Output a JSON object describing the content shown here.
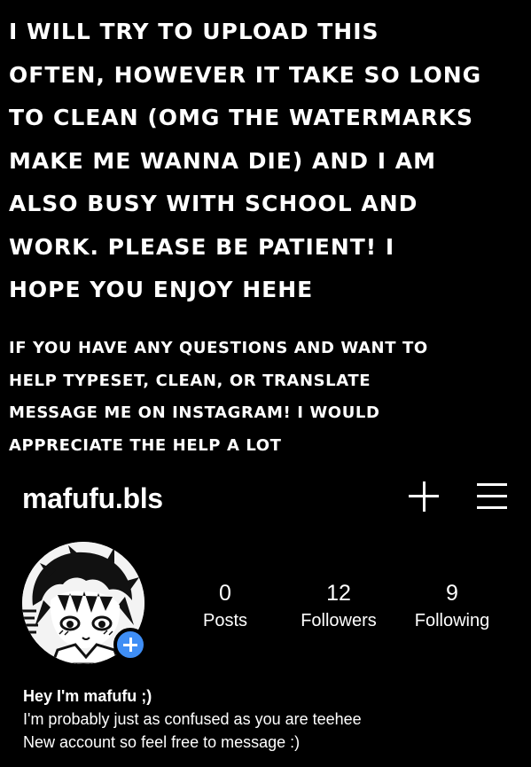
{
  "notes": {
    "main": "I will try to upload this\noften, however it take so long\nto clean (OMG the watermarks\nmake me wanna die) and I am\nalso busy with school and\nwork. Please be patient! I\nhope you enjoy hehe",
    "sub": "If you have any questions and want to\nhelp typeset, clean, or translate\nmessage me on instagram! I would\nappreciate the help a lot"
  },
  "profile": {
    "username": "mafufu.bls",
    "stats": [
      {
        "value": "0",
        "label": "Posts"
      },
      {
        "value": "12",
        "label": "Followers"
      },
      {
        "value": "9",
        "label": "Following"
      }
    ],
    "bio_name": "Hey I'm mafufu ;)",
    "bio_lines": [
      "I'm probably just as confused as you are teehee",
      "New account so feel free to message :)"
    ]
  },
  "icons": {
    "create": "plus-icon",
    "menu": "hamburger-menu-icon",
    "add_story": "plus-icon",
    "accent": "#3f8ef5"
  }
}
